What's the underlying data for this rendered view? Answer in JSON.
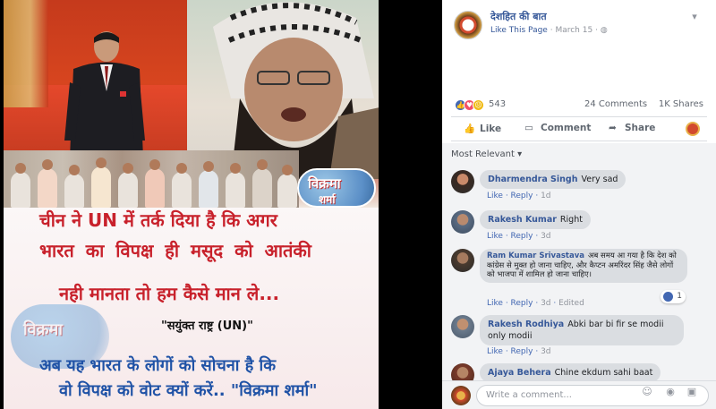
{
  "poster": {
    "logo_line1": "विक्रमा",
    "logo_line2": "शर्मा",
    "line1": "चीन ने UN में तर्क दिया है कि अगर",
    "line2": "भारत का विपक्ष ही मसूद को आतंकी",
    "line3": "नही मानता तो हम कैसे मान ले...",
    "line4": "\"सयुंक्त राष्ट्र (UN)\"",
    "line5": "अब यह भारत के लोगों को सोचना है कि",
    "line6": "वो विपक्ष को वोट क्यों करें..  \"विक्रमा शर्मा\"",
    "watermark": "विक्रमा"
  },
  "post": {
    "page_name": "देशहित की बात",
    "like_page": "Like This Page",
    "date": "March 15",
    "reaction_count": "543",
    "comments_count": "24 Comments",
    "shares_count": "1K Shares",
    "actions": {
      "like": "Like",
      "comment": "Comment",
      "share": "Share"
    },
    "icons": {
      "like": "thumb-up-icon",
      "comment": "speech-bubble-icon",
      "share": "share-arrow-icon"
    }
  },
  "comments": {
    "sort_label": "Most Relevant ▾",
    "items": [
      {
        "name": "Dharmendra Singh",
        "text": "Very sad",
        "like": "Like",
        "reply": "Reply",
        "time": "1d",
        "edited": ""
      },
      {
        "name": "Rakesh Kumar",
        "text": "Right",
        "like": "Like",
        "reply": "Reply",
        "time": "3d",
        "edited": ""
      },
      {
        "name": "Ram Kumar Srivastava",
        "text": "अब समय आ गया है कि देश को कांग्रेस से मुक्त हो जाना चाहिए, और कैप्टन अमरिंदर सिंह जैसे लोगों को भाजपा में शामिल हो जाना चाहिए।",
        "like": "Like",
        "reply": "Reply",
        "time": "3d",
        "edited": "Edited",
        "reactions": "1"
      },
      {
        "name": "Rakesh Rodhiya",
        "text": "Abki bar bi fir se modii only modii",
        "like": "Like",
        "reply": "Reply",
        "time": "3d",
        "edited": ""
      },
      {
        "name": "Ajaya Behera",
        "text": "Chine ekdum sahi baat",
        "like": "",
        "reply": "",
        "time": "",
        "edited": ""
      }
    ],
    "write_placeholder": "Write a comment..."
  },
  "colors": {
    "fb_blue": "#365899",
    "poster_red": "#c8212b",
    "poster_blue": "#1f52a6"
  }
}
